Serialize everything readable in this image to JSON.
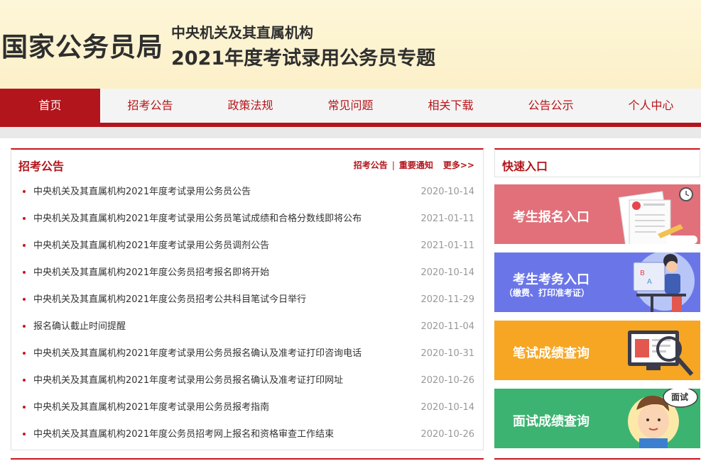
{
  "header": {
    "logo": "国家公务员局",
    "subtitle": "中央机关及其直属机构",
    "title": "2021年度考试录用公务员专题"
  },
  "nav": [
    "首页",
    "招考公告",
    "政策法规",
    "常见问题",
    "相关下载",
    "公告公示",
    "个人中心"
  ],
  "notices": {
    "title": "招考公告",
    "link1": "招考公告",
    "separator": "|",
    "link2": "重要通知",
    "more": "更多>>",
    "items": [
      {
        "title": "中央机关及其直属机构2021年度考试录用公务员公告",
        "date": "2020-10-14"
      },
      {
        "title": "中央机关及其直属机构2021年度考试录用公务员笔试成绩和合格分数线即将公布",
        "date": "2021-01-11"
      },
      {
        "title": "中央机关及其直属机构2021年度考试录用公务员调剂公告",
        "date": "2021-01-11"
      },
      {
        "title": "中央机关及其直属机构2021年度公务员招考报名即将开始",
        "date": "2020-10-14"
      },
      {
        "title": "中央机关及其直属机构2021年度公务员招考公共科目笔试今日举行",
        "date": "2020-11-29"
      },
      {
        "title": "报名确认截止时间提醒",
        "date": "2020-11-04"
      },
      {
        "title": "中央机关及其直属机构2021年度考试录用公务员报名确认及准考证打印咨询电话",
        "date": "2020-10-31"
      },
      {
        "title": "中央机关及其直属机构2021年度考试录用公务员报名确认及准考证打印网址",
        "date": "2020-10-26"
      },
      {
        "title": "中央机关及其直属机构2021年度考试录用公务员报考指南",
        "date": "2020-10-14"
      },
      {
        "title": "中央机关及其直属机构2021年度公务员招考网上报名和资格审查工作结束",
        "date": "2020-10-26"
      }
    ]
  },
  "quick": {
    "title": "快速入口",
    "cards": [
      {
        "label": "考生报名入口",
        "color": "#e2707a"
      },
      {
        "label": "考生考务入口",
        "sub": "（缴费、打印准考证）",
        "color": "#6a76e8"
      },
      {
        "label": "笔试成绩查询",
        "color": "#f6a623"
      },
      {
        "label": "面试成绩查询",
        "bubble": "面试",
        "color": "#3cb371"
      }
    ]
  },
  "colors": {
    "brand_red": "#b2151b",
    "nav_bg": "#f4f4f4",
    "header_bg": "#fcf0c9"
  }
}
